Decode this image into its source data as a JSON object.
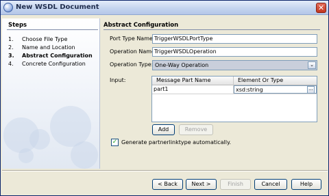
{
  "window": {
    "title": "New WSDL Document",
    "close_glyph": "✕"
  },
  "steps": {
    "title": "Steps",
    "items": [
      {
        "num": "1.",
        "label": "Choose File Type",
        "current": false
      },
      {
        "num": "2.",
        "label": "Name and Location",
        "current": false
      },
      {
        "num": "3.",
        "label": "Abstract Configuration",
        "current": true
      },
      {
        "num": "4.",
        "label": "Concrete Configuration",
        "current": false
      }
    ]
  },
  "main": {
    "title": "Abstract Configuration",
    "port_type": {
      "label": "Port Type Name:",
      "value": "TriggerWSDLPortType"
    },
    "operation": {
      "label": "Operation Name:",
      "value": "TriggerWSDLOperation"
    },
    "operation_type": {
      "label": "Operation Type:",
      "value": "One-Way Operation",
      "arrow": "⌄"
    },
    "input": {
      "label": "Input:",
      "columns": [
        "Message Part Name",
        "Element Or Type"
      ],
      "rows": [
        {
          "part": "part1",
          "type": "xsd:string"
        }
      ],
      "browse_label": "..."
    },
    "add_label": "Add",
    "remove_label": "Remove",
    "checkbox": {
      "checked": true,
      "mark": "✓",
      "label": "Generate partnerlinktype automatically."
    }
  },
  "footer": {
    "back": "< Back",
    "next": "Next >",
    "finish": "Finish",
    "cancel": "Cancel",
    "help": "Help"
  },
  "colors": {
    "accent": "#0a246a",
    "panel": "#ece9d8",
    "combo_fill": "#c9cfdb"
  }
}
